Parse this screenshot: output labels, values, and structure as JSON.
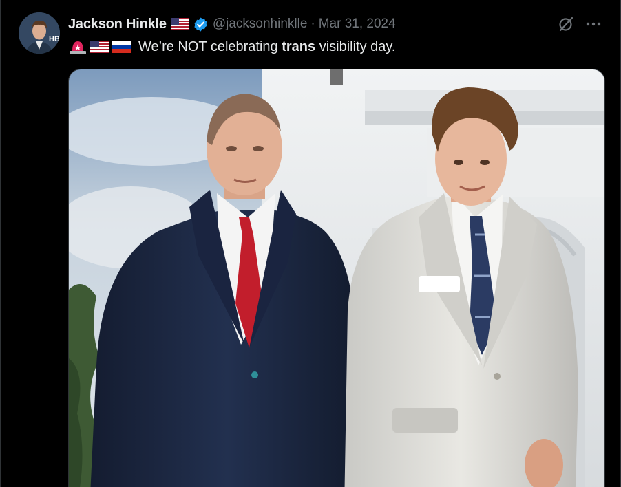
{
  "tweet": {
    "author": {
      "display_name": "Jackson Hinkle",
      "handle": "@jacksonhinklle",
      "avatar_text": "HB"
    },
    "separator": "·",
    "date": "Mar 31, 2024",
    "text": {
      "before": "We’re NOT celebrating ",
      "bold": "trans",
      "after": " visibility day."
    },
    "emojis": [
      "siren-emoji",
      "us-flag-emoji",
      "russia-flag-emoji"
    ],
    "icons": {
      "grok": "grok-icon",
      "more": "more-icon",
      "verified": "verified-badge-icon",
      "name_flag": "us-flag-icon"
    }
  },
  "colors": {
    "background": "#000000",
    "text": "#e7e9ea",
    "secondary": "#71767b",
    "verified": "#1d9bf0",
    "border": "#2f3336"
  }
}
